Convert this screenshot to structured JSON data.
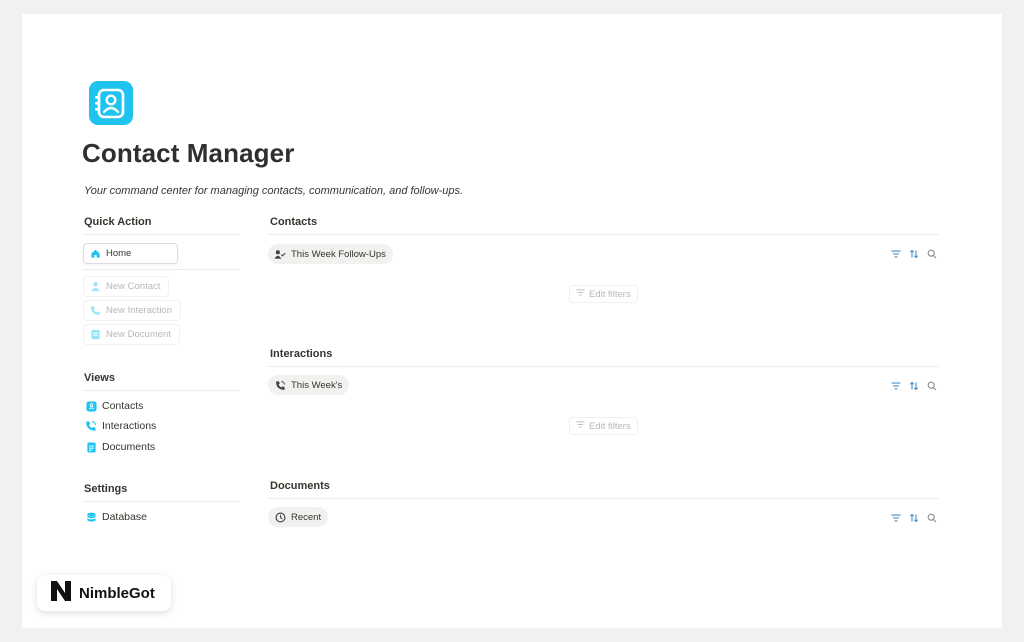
{
  "page": {
    "title": "Contact Manager",
    "subtitle": "Your command center for managing contacts, communication, and follow-ups.",
    "app_icon": "contact-book-icon"
  },
  "quick_action": {
    "heading": "Quick Action",
    "items": [
      {
        "label": "Home",
        "icon": "home-icon",
        "active": true
      },
      {
        "label": "New Contact",
        "icon": "person-icon",
        "active": false
      },
      {
        "label": "New Interaction",
        "icon": "phone-icon",
        "active": false
      },
      {
        "label": "New Document",
        "icon": "document-icon",
        "active": false
      }
    ]
  },
  "views": {
    "heading": "Views",
    "items": [
      {
        "label": "Contacts",
        "icon": "contact-book-icon"
      },
      {
        "label": "Interactions",
        "icon": "phone-icon"
      },
      {
        "label": "Documents",
        "icon": "document-icon"
      }
    ]
  },
  "settings": {
    "heading": "Settings",
    "items": [
      {
        "label": "Database",
        "icon": "database-icon"
      }
    ]
  },
  "sections": [
    {
      "heading": "Contacts",
      "view_label": "This Week Follow-Ups",
      "view_icon": "person-check-icon",
      "edit_filters": "Edit filters"
    },
    {
      "heading": "Interactions",
      "view_label": "This Week's",
      "view_icon": "phone-icon",
      "edit_filters": "Edit filters"
    },
    {
      "heading": "Documents",
      "view_label": "Recent",
      "view_icon": "clock-icon"
    }
  ],
  "brand": {
    "name": "NimbleGot",
    "logo": "n-logo-icon"
  },
  "colors": {
    "accent": "#1ec4ee",
    "tool_icon": "#4a90c8",
    "text": "#37352f"
  }
}
